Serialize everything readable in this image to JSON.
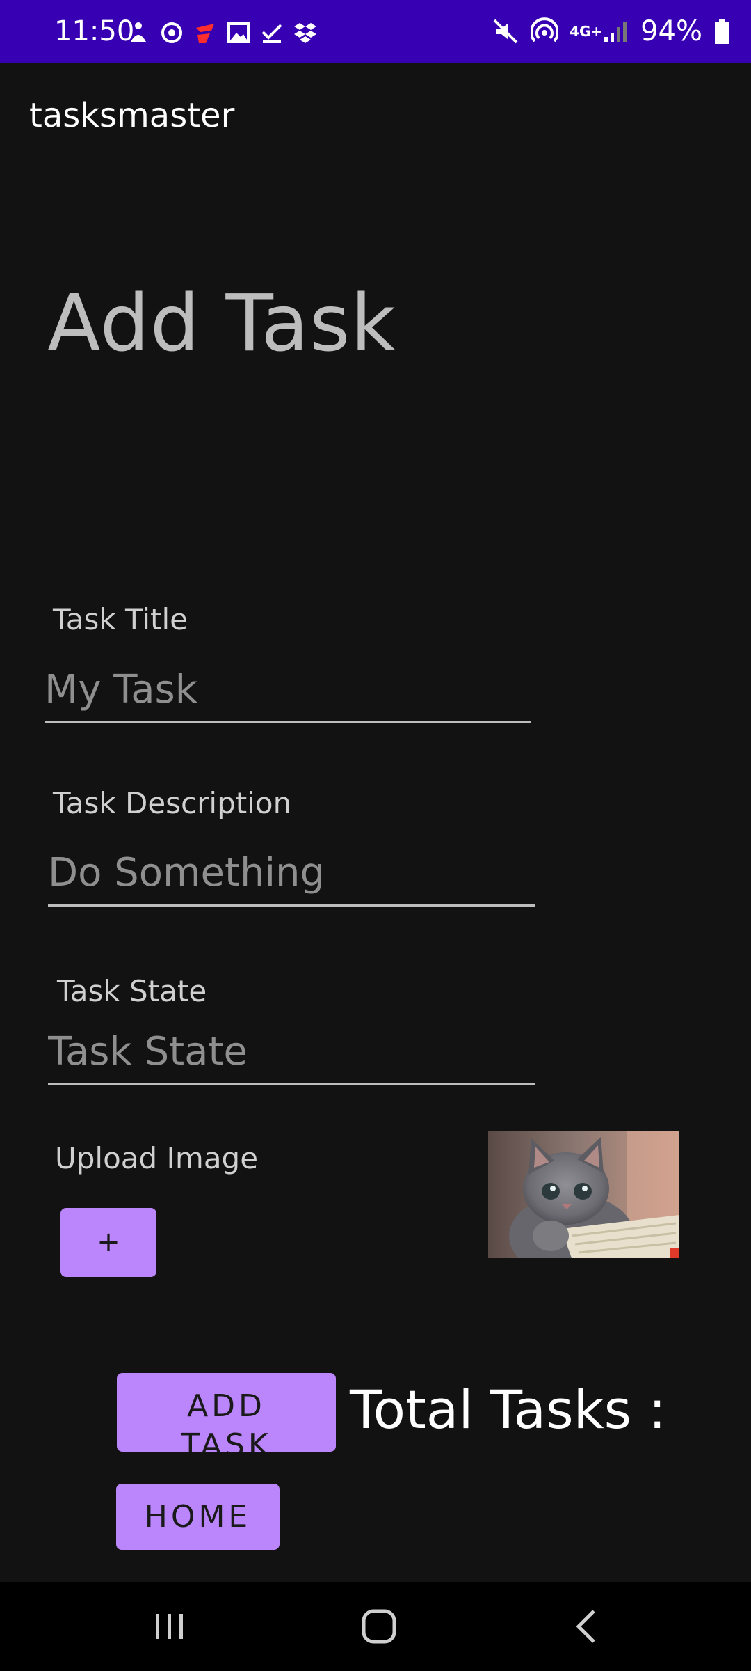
{
  "status_bar": {
    "time": "11:50",
    "battery": "94%",
    "network": "4G+",
    "left_icons": [
      "accessibility-icon",
      "sync-icon",
      "app-notification-icon",
      "image-icon",
      "checkmark-icon",
      "dropbox-icon"
    ],
    "right_icons": [
      "mute-icon",
      "hotspot-icon",
      "signal-icon",
      "battery-icon"
    ]
  },
  "app": {
    "title": "tasksmaster"
  },
  "page": {
    "heading": "Add Task"
  },
  "form": {
    "title_label": "Task Title",
    "title_placeholder": "My Task",
    "description_label": "Task Description",
    "description_placeholder": "Do Something",
    "state_label": "Task State",
    "state_placeholder": "Task State",
    "upload_label": "Upload Image",
    "upload_button": "+"
  },
  "actions": {
    "add_task": "ADD TASK",
    "home": "HOME",
    "total_tasks": "Total Tasks :"
  },
  "colors": {
    "status_bar": "#3700B3",
    "accent": "#BB86FC",
    "background": "#121212"
  },
  "nav": {
    "icons": [
      "recent-apps-icon",
      "home-icon",
      "back-icon"
    ]
  }
}
